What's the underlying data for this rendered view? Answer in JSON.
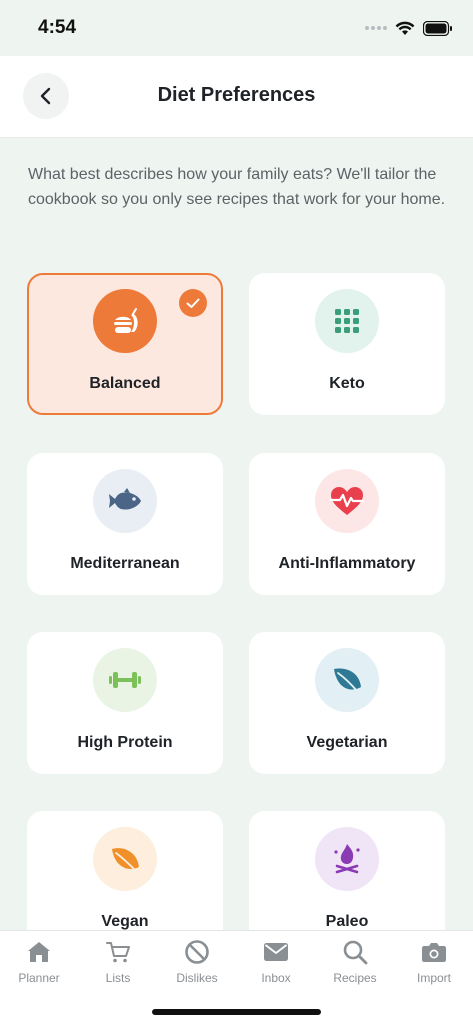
{
  "status": {
    "time": "4:54"
  },
  "header": {
    "title": "Diet Preferences"
  },
  "intro": "What best describes how your family eats? We'll tailor the cookbook so you only see recipes that work for your home.",
  "diets": [
    {
      "label": "Balanced",
      "selected": true,
      "icon": "balanced-food-icon",
      "icon_bg": "#ee7a3a",
      "icon_color": "#ffffff"
    },
    {
      "label": "Keto",
      "selected": false,
      "icon": "keto-dots-icon",
      "icon_bg": "#e2f2ec",
      "icon_color": "#3a9e7a"
    },
    {
      "label": "Mediterranean",
      "selected": false,
      "icon": "fish-icon",
      "icon_bg": "#e8eef4",
      "icon_color": "#4a6585"
    },
    {
      "label": "Anti-Inflammatory",
      "selected": false,
      "icon": "heartbeat-icon",
      "icon_bg": "#fde6e6",
      "icon_color": "#e8414d"
    },
    {
      "label": "High Protein",
      "selected": false,
      "icon": "dumbbell-icon",
      "icon_bg": "#eaf4e4",
      "icon_color": "#7cc05a"
    },
    {
      "label": "Vegetarian",
      "selected": false,
      "icon": "leaf-icon",
      "icon_bg": "#e2eff5",
      "icon_color": "#2e7a94"
    },
    {
      "label": "Vegan",
      "selected": false,
      "icon": "vegan-leaf-icon",
      "icon_bg": "#fdeedd",
      "icon_color": "#f0902a"
    },
    {
      "label": "Paleo",
      "selected": false,
      "icon": "campfire-icon",
      "icon_bg": "#f0e4f7",
      "icon_color": "#8a3ab3"
    }
  ],
  "tabs": [
    {
      "label": "Planner",
      "icon": "home-icon"
    },
    {
      "label": "Lists",
      "icon": "cart-icon"
    },
    {
      "label": "Dislikes",
      "icon": "ban-icon"
    },
    {
      "label": "Inbox",
      "icon": "mail-icon"
    },
    {
      "label": "Recipes",
      "icon": "search-icon"
    },
    {
      "label": "Import",
      "icon": "camera-icon"
    }
  ],
  "colors": {
    "accent": "#ee7a3a",
    "tab_inactive": "#8a8f94",
    "background": "#eef5f1"
  }
}
